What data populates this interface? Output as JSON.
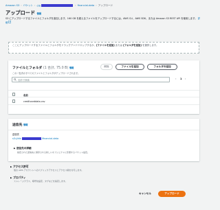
{
  "breadcrumb": {
    "items": [
      "Amazon S3",
      "バケット",
      "ctb",
      "financial-data",
      "アップロード"
    ]
  },
  "page": {
    "title": "アップロード",
    "info_label": "情報",
    "description_line1": "S3 にアップロードするファイルとフォルダを追加します。160 GB を超えるファイルをアップロードするには、AWS CLI、AWS",
    "description_line2": "SDK、または Amazon S3 REST API を使用します。",
    "learn_more": "詳細"
  },
  "dropzone": {
    "text_pre": "ここにアップロードするファイルとフォルダをドラッグアンドドロップするか、",
    "add_files_bold": "[ファイルを追加]",
    "text_mid": " または ",
    "add_folder_bold": "[フォルダを追加]",
    "text_post": " を選択します。"
  },
  "files_panel": {
    "title": "ファイルとフォルダ",
    "count": "(1 合計, 75.0 B)",
    "info_label": "情報",
    "subtitle": "この一覧内のすべてのファイルとフォルダがアップロードされます。",
    "remove_button": "削除",
    "add_files_button": "ファイルを追加",
    "add_folder_button": "フォルダの追加",
    "search_placeholder": "名前で検索",
    "page_number": "1",
    "columns": [
      "名前"
    ],
    "rows": [
      {
        "name": "creditcarddata.csv"
      }
    ]
  },
  "destination": {
    "title": "送信先",
    "info_label": "情報",
    "label": "送信先",
    "path_prefix": "s3://ctb",
    "path_suffix": "/financial-data",
    "details_title": "送信先の詳細",
    "details_desc": "指定された送信先に保存される新しいオブジェクトに影響するバケット設定。"
  },
  "permissions": {
    "title": "アクセス許可",
    "desc": "他の AWS アカウントへのパブリックアクセスとアクセス権を付与します。"
  },
  "properties": {
    "title": "プロパティ",
    "desc": "ストレージクラス、暗号化設定、タグなどを指定します。"
  },
  "footer": {
    "cancel_button": "キャンセル",
    "upload_button": "アップロード"
  },
  "colors": {
    "link": "#0073bb",
    "primary": "#ec7211",
    "redaction": "#3b3bcf",
    "background": "#f2f3f3"
  }
}
